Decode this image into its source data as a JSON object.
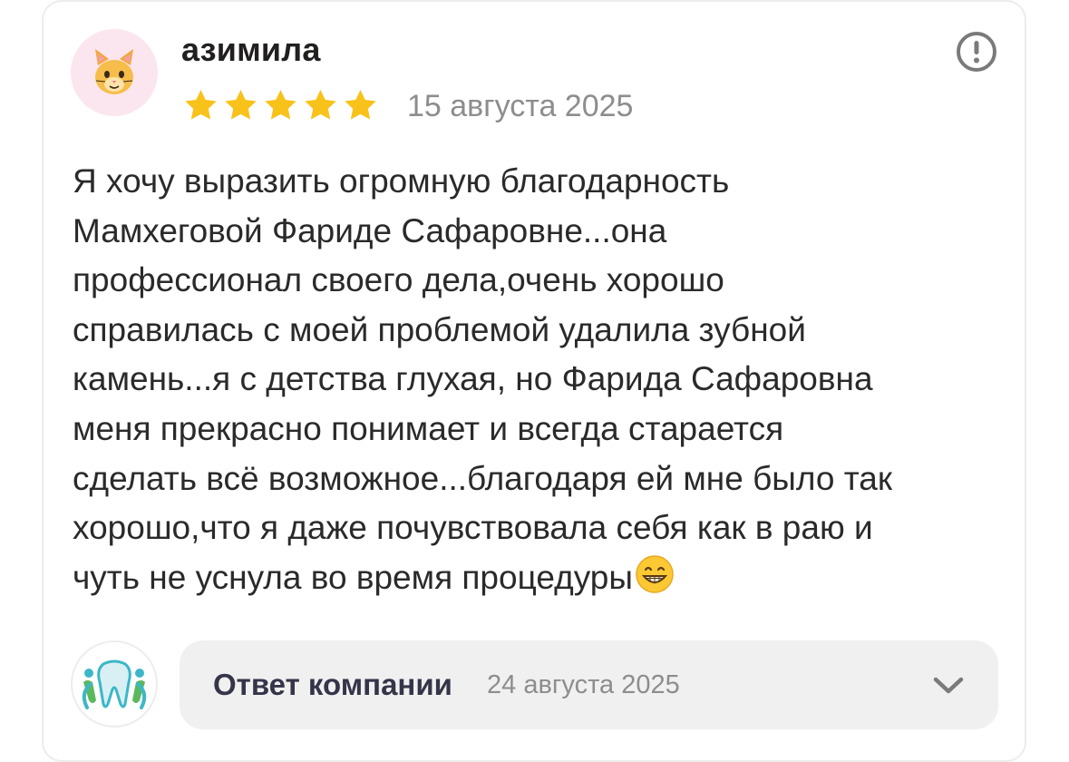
{
  "review": {
    "author": "азимила",
    "avatar_icon": "cat-face-icon",
    "rating": 5,
    "max_rating": 5,
    "date": "15 августа 2025",
    "text_lines": [
      "Я хочу выразить огромную благодарность",
      "Мамхеговой Фариде Сафаровне...она",
      "профессионал своего дела,очень хорошо",
      "справилась с моей проблемой удалила зубной",
      "камень...я с детства глухая, но Фарида Сафаровна",
      "меня прекрасно понимает и всегда старается",
      "сделать всё возможное...благодаря ей мне было так",
      "хорошо,что я даже почувствовала себя как в раю и",
      "чуть не уснула во время процедуры"
    ],
    "trailing_emoji": "grinning-face-emoji",
    "report_icon": "exclamation-circle-icon"
  },
  "company_reply": {
    "logo_icon": "tooth-logo-icon",
    "title": "Ответ компании",
    "date": "24 августа 2025",
    "expand_icon": "chevron-down-icon"
  },
  "colors": {
    "star": "#f9c21b",
    "author": "#21201f",
    "muted": "#8d8d8d",
    "text": "#2a2a2a",
    "reply_bg": "#f0f0f0",
    "avatar_bg": "#fbe6ef",
    "logo_teal": "#3cb7c8",
    "logo_green": "#5cb85c"
  }
}
